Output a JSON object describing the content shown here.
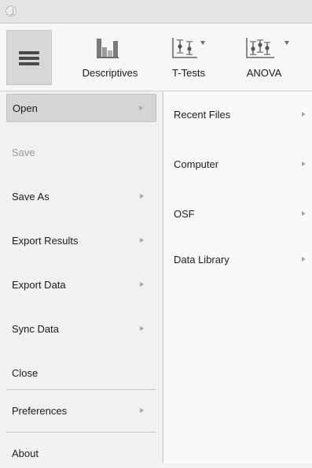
{
  "toolbar": {
    "descriptives_label": "Descriptives",
    "ttests_label": "T-Tests",
    "anova_label": "ANOVA"
  },
  "file_menu": {
    "items": [
      {
        "label": "Open",
        "has_submenu": true,
        "state": "selected"
      },
      {
        "label": "Save",
        "has_submenu": false,
        "state": "disabled"
      },
      {
        "label": "Save As",
        "has_submenu": true
      },
      {
        "label": "Export Results",
        "has_submenu": true
      },
      {
        "label": "Export Data",
        "has_submenu": true
      },
      {
        "label": "Sync Data",
        "has_submenu": true
      },
      {
        "label": "Close",
        "has_submenu": false
      },
      {
        "label": "Preferences",
        "has_submenu": true
      },
      {
        "label": "About",
        "has_submenu": false
      }
    ]
  },
  "open_submenu": {
    "items": [
      {
        "label": "Recent Files",
        "has_submenu": true
      },
      {
        "label": "Computer",
        "has_submenu": true
      },
      {
        "label": "OSF",
        "has_submenu": true
      },
      {
        "label": "Data Library",
        "has_submenu": true
      }
    ]
  },
  "colors": {
    "selected_item_bg": "#d5d5d5",
    "disabled_text": "#9a9a9a",
    "icon_gray": "#7a7a7a"
  }
}
